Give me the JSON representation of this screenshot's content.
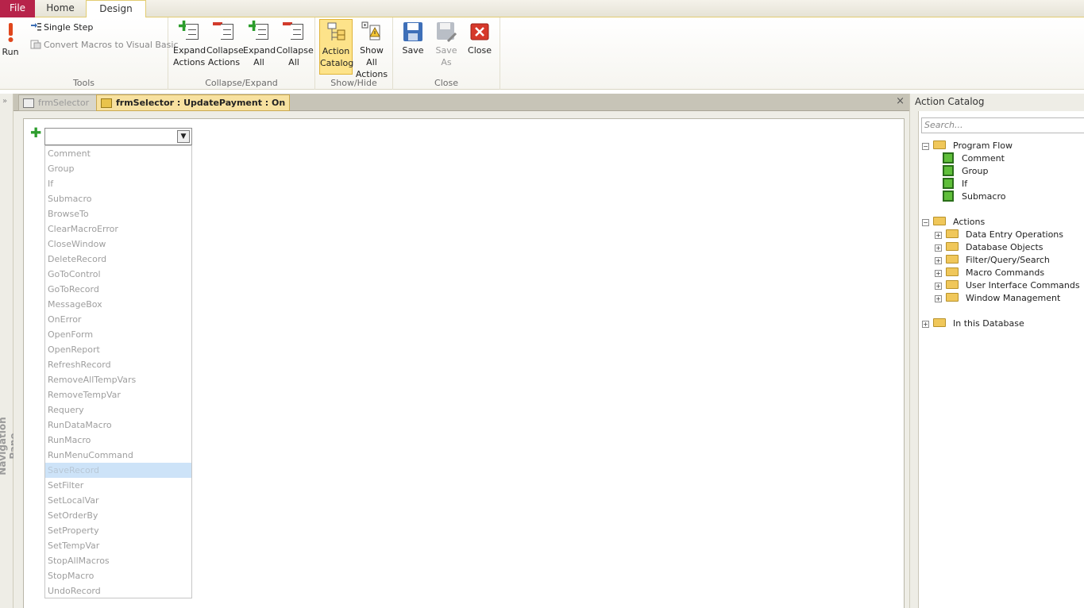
{
  "ribbon_tabs": {
    "file": "File",
    "home": "Home",
    "design": "Design"
  },
  "tools": {
    "run": "Run",
    "single_step": "Single Step",
    "convert": "Convert Macros to Visual Basic",
    "group": "Tools"
  },
  "collapse_expand": {
    "expand_actions": [
      "Expand",
      "Actions"
    ],
    "collapse_actions": [
      "Collapse",
      "Actions"
    ],
    "expand_all": [
      "Expand",
      "All"
    ],
    "collapse_all": [
      "Collapse",
      "All"
    ],
    "group": "Collapse/Expand"
  },
  "show_hide": {
    "action_catalog": [
      "Action",
      "Catalog"
    ],
    "show_all_actions": [
      "Show All",
      "Actions"
    ],
    "group": "Show/Hide"
  },
  "close_group": {
    "save": "Save",
    "save_as": [
      "Save",
      "As"
    ],
    "close": "Close",
    "group": "Close"
  },
  "nav_pane": {
    "label": "Navigation Pane",
    "chevron": "»"
  },
  "doc_tabs": {
    "tab1": "frmSelector",
    "tab2": "frmSelector : UpdatePayment : On Click",
    "close": "×"
  },
  "editor": {
    "combo_value": "",
    "options": [
      "Comment",
      "Group",
      "If",
      "Submacro",
      "BrowseTo",
      "ClearMacroError",
      "CloseWindow",
      "DeleteRecord",
      "GoToControl",
      "GoToRecord",
      "MessageBox",
      "OnError",
      "OpenForm",
      "OpenReport",
      "RefreshRecord",
      "RemoveAllTempVars",
      "RemoveTempVar",
      "Requery",
      "RunDataMacro",
      "RunMacro",
      "RunMenuCommand",
      "SaveRecord",
      "SetFilter",
      "SetLocalVar",
      "SetOrderBy",
      "SetProperty",
      "SetTempVar",
      "StopAllMacros",
      "StopMacro",
      "UndoRecord"
    ],
    "selected_index": 21
  },
  "catalog": {
    "title": "Action Catalog",
    "search_placeholder": "Search...",
    "program_flow": "Program Flow",
    "program_flow_items": [
      "Comment",
      "Group",
      "If",
      "Submacro"
    ],
    "actions": "Actions",
    "action_folders": [
      "Data Entry Operations",
      "Database Objects",
      "Filter/Query/Search",
      "Macro Commands",
      "User Interface Commands",
      "Window Management"
    ],
    "in_this_database": "In this Database"
  }
}
